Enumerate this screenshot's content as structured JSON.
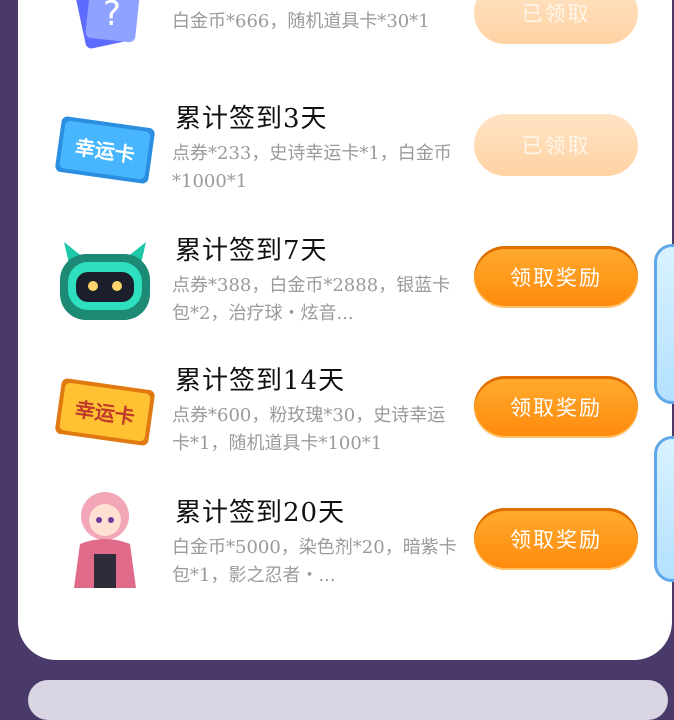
{
  "rows": [
    {
      "title": "",
      "desc": "白金币*666，随机道具卡*30*1",
      "button": "已领取",
      "state": "claimed",
      "icon": "mystery-card-icon"
    },
    {
      "title": "累计签到3天",
      "desc": "点券*233，史诗幸运卡*1，白金币*1000*1",
      "button": "已领取",
      "state": "claimed",
      "icon": "lucky-card-blue-icon",
      "icon_text": "幸运卡"
    },
    {
      "title": "累计签到7天",
      "desc": "点券*388，白金币*2888，银蓝卡包*2，治疗球・炫音...",
      "button": "领取奖励",
      "state": "active",
      "icon": "robot-pet-icon"
    },
    {
      "title": "累计签到14天",
      "desc": "点券*600，粉玫瑰*30，史诗幸运卡*1，随机道具卡*100*1",
      "button": "领取奖励",
      "state": "active",
      "icon": "lucky-card-gold-icon",
      "icon_text": "幸运卡"
    },
    {
      "title": "累计签到20天",
      "desc": "白金币*5000，染色剂*20，暗紫卡包*1，影之忍者・...",
      "button": "领取奖励",
      "state": "active",
      "icon": "ninja-character-icon"
    }
  ],
  "colors": {
    "accent": "#ff8a0d",
    "claimed": "#ffd9b0",
    "background": "#4a3a6a"
  }
}
